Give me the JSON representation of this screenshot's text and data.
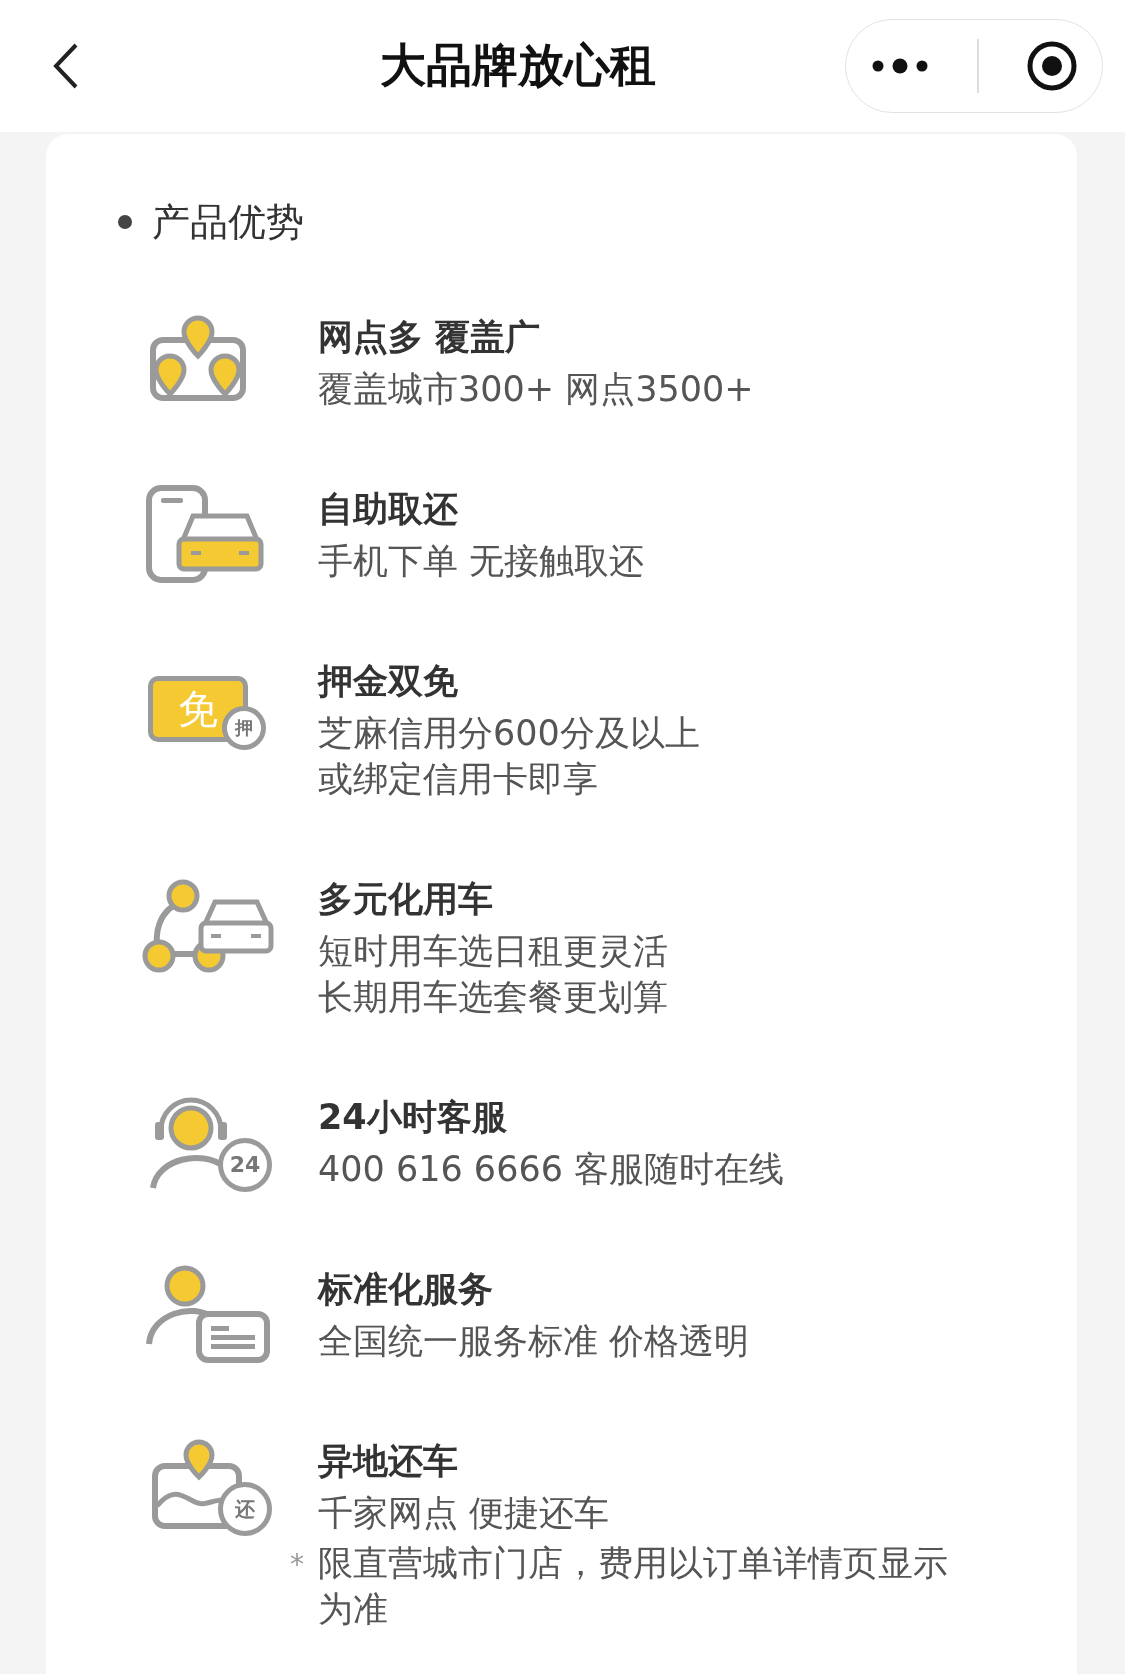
{
  "nav": {
    "title": "大品牌放心租"
  },
  "section": {
    "title": "产品优势"
  },
  "features": [
    {
      "kind": "map-pins",
      "title": "网点多 覆盖广",
      "lines": [
        "覆盖城市300+  网点3500+"
      ]
    },
    {
      "kind": "phone-car",
      "title": "自助取还",
      "lines": [
        "手机下单 无接触取还"
      ]
    },
    {
      "kind": "deposit",
      "icon_text": "免",
      "badge": "押",
      "title": "押金双免",
      "lines": [
        "芝麻信用分600分及以上",
        "或绑定信用卡即享"
      ]
    },
    {
      "kind": "multi-car",
      "title": "多元化用车",
      "lines": [
        "短时用车选日租更灵活",
        "长期用车选套餐更划算"
      ]
    },
    {
      "kind": "support",
      "badge": "24",
      "title": "24小时客服",
      "lines": [
        "400 616 6666 客服随时在线"
      ]
    },
    {
      "kind": "service",
      "title": "标准化服务",
      "lines": [
        "全国统一服务标准  价格透明"
      ]
    },
    {
      "kind": "return",
      "badge": "还",
      "title": "异地还车",
      "lines": [
        "千家网点 便捷还车"
      ],
      "note": {
        "mark": "*",
        "text": "限直营城市门店，费用以订单详情页显示为准"
      }
    }
  ]
}
